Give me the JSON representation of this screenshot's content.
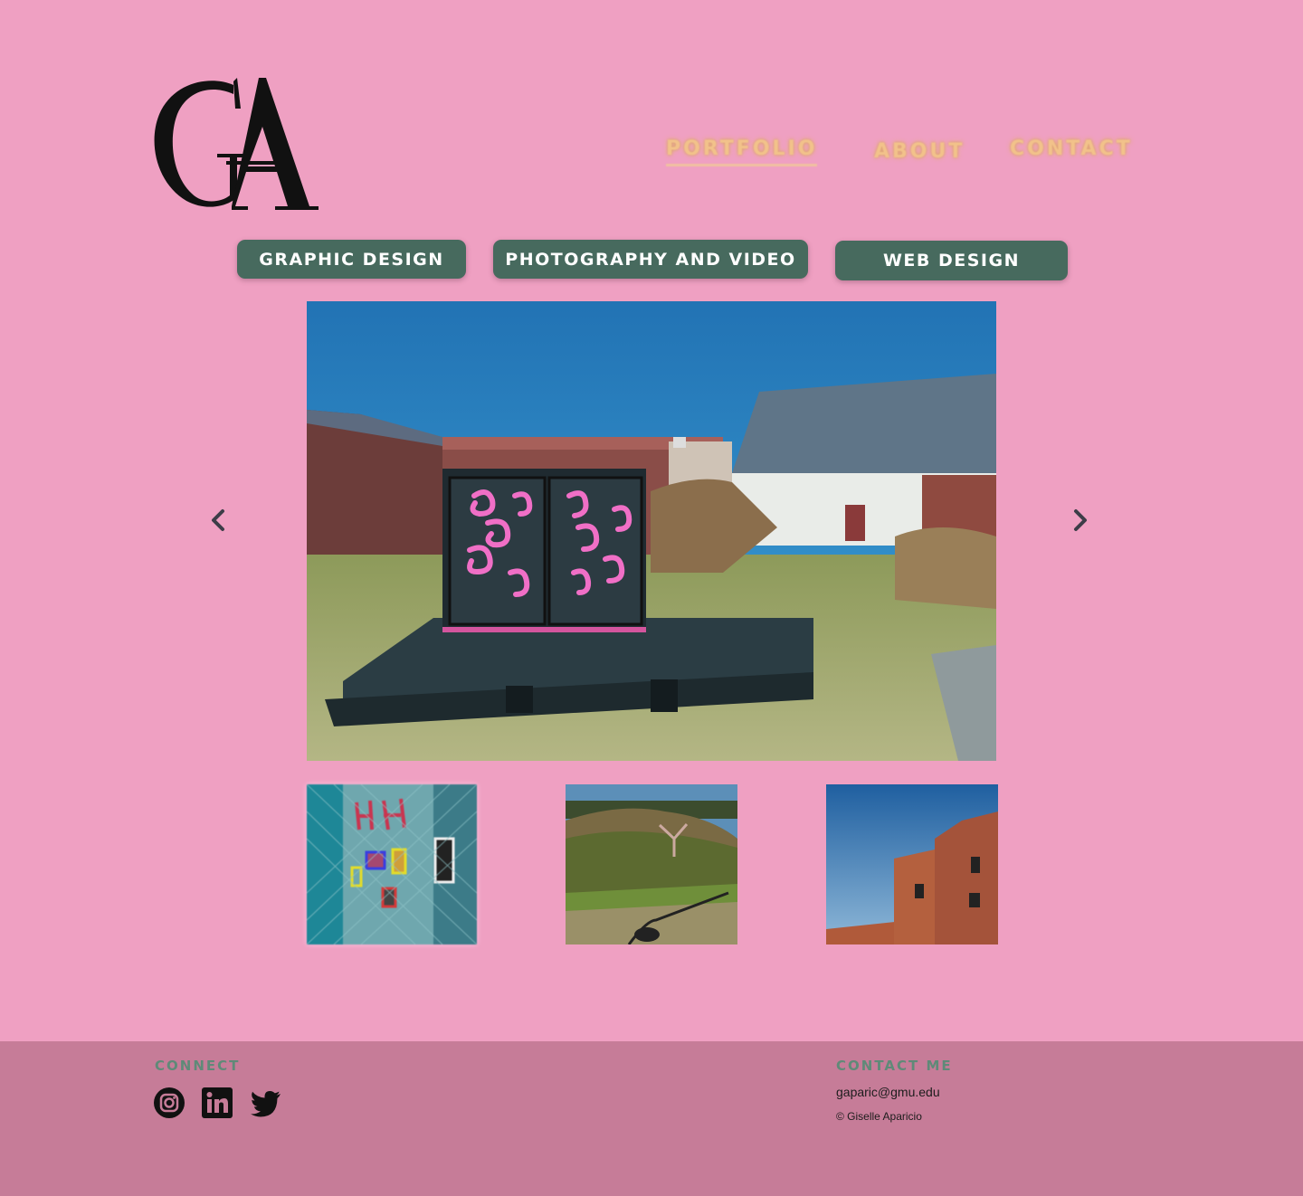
{
  "logo": {
    "text": "GA"
  },
  "nav": {
    "items": [
      {
        "label": "PORTFOLIO",
        "active": true
      },
      {
        "label": "ABOUT",
        "active": false
      },
      {
        "label": "CONTACT",
        "active": false
      }
    ]
  },
  "categories": [
    {
      "label": "GRAPHIC DESIGN"
    },
    {
      "label": "PHOTOGRAPHY AND VIDEO"
    },
    {
      "label": "WEB DESIGN"
    }
  ],
  "carousel": {
    "prev_icon": "chevron-left-icon",
    "next_icon": "chevron-right-icon",
    "thumbnails": [
      "graffiti-wall-thumbnail",
      "field-hill-thumbnail",
      "brick-building-thumbnail"
    ]
  },
  "footer": {
    "connect_heading": "CONNECT",
    "social": [
      "instagram-icon",
      "linkedin-icon",
      "twitter-icon"
    ],
    "contact_heading": "CONTACT ME",
    "email": "gaparic@gmu.edu",
    "copyright": "© Giselle Aparicio"
  },
  "colors": {
    "page_bg": "#efa0c2",
    "footer_bg": "#c67c98",
    "button_bg": "#476a5e",
    "nav_text": "#f2c28a",
    "footer_heading": "#5f8a78"
  }
}
